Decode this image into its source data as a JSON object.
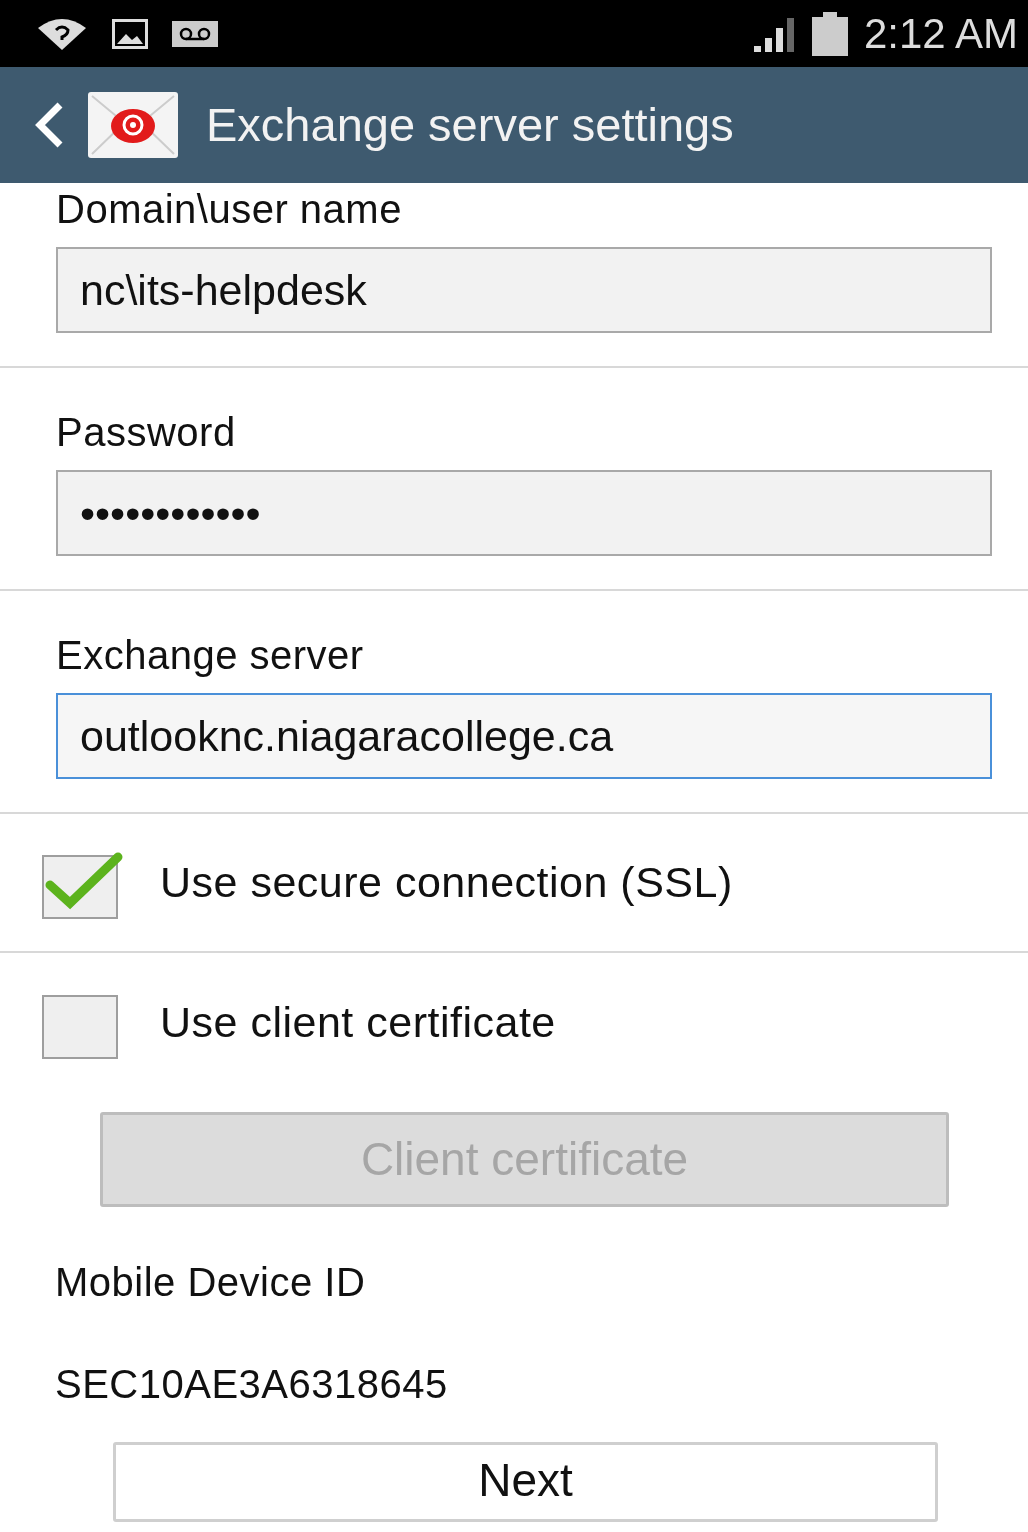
{
  "status_bar": {
    "time": "2:12 AM"
  },
  "header": {
    "title": "Exchange server settings"
  },
  "fields": [
    {
      "label": "Domain\\user name",
      "value": "nc\\its-helpdesk",
      "focused": false
    },
    {
      "label": "Password",
      "value": "••••••••••••",
      "focused": false
    },
    {
      "label": "Exchange server",
      "value": "outlooknc.niagaracollege.ca",
      "focused": true
    }
  ],
  "options": [
    {
      "label": "Use secure connection (SSL)",
      "checked": true
    },
    {
      "label": "Use client certificate",
      "checked": false
    }
  ],
  "certificate_button": {
    "label": "Client certificate",
    "disabled": true
  },
  "device_id": {
    "label": "Mobile Device ID",
    "value": "SEC10AE3A6318645"
  },
  "next_button": {
    "label": "Next"
  }
}
